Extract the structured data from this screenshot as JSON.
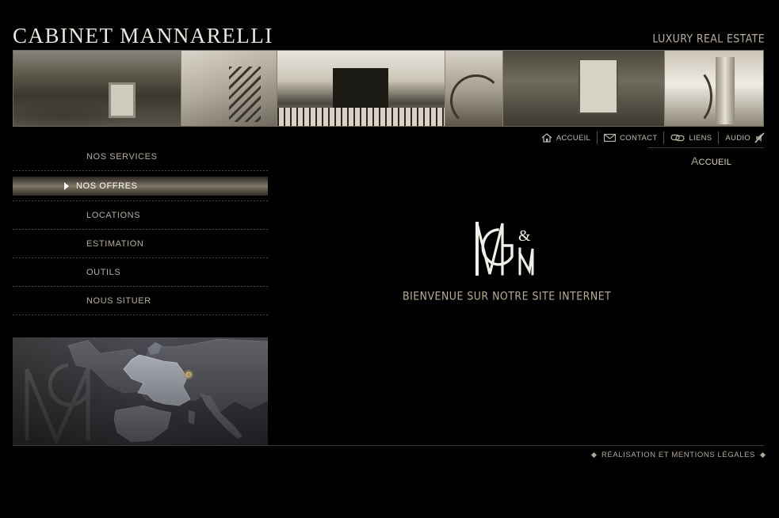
{
  "header": {
    "brand": "CABINET MANNARELLI",
    "tagline": "LUXURY REAL ESTATE"
  },
  "banner": {
    "photos": [
      "house-garden-photo",
      "staircase-photo",
      "balcony-photo",
      "spiral-stair-photo",
      "ivy-window-photo",
      "column-hall-photo"
    ]
  },
  "topnav": {
    "items": [
      {
        "label": "ACCUEIL",
        "icon": "home-icon"
      },
      {
        "label": "CONTACT",
        "icon": "mail-icon"
      },
      {
        "label": "LIENS",
        "icon": "link-icon"
      },
      {
        "label": "AUDIO",
        "icon": "speaker-muted-icon"
      }
    ]
  },
  "breadcrumb": {
    "first_letter": "A",
    "rest": "CCUEIL"
  },
  "sidemenu": {
    "items": [
      {
        "label": "NOS SERVICES",
        "active": false
      },
      {
        "label": "NOS OFFRES",
        "active": true
      },
      {
        "label": "LOCATIONS",
        "active": false
      },
      {
        "label": "ESTIMATION",
        "active": false
      },
      {
        "label": "OUTILS",
        "active": false
      },
      {
        "label": "NOUS SITUER",
        "active": false
      }
    ]
  },
  "map": {
    "icon": "europe-map"
  },
  "main": {
    "logo": "GM monogram",
    "welcome": "BIENVENUE SUR NOTRE SITE INTERNET"
  },
  "footer": {
    "link": "RÉALISATION ET MENTIONS LÉGALES"
  },
  "colors": {
    "background": "#000000",
    "text": "#c9c2b4",
    "accent": "#7e7564"
  }
}
